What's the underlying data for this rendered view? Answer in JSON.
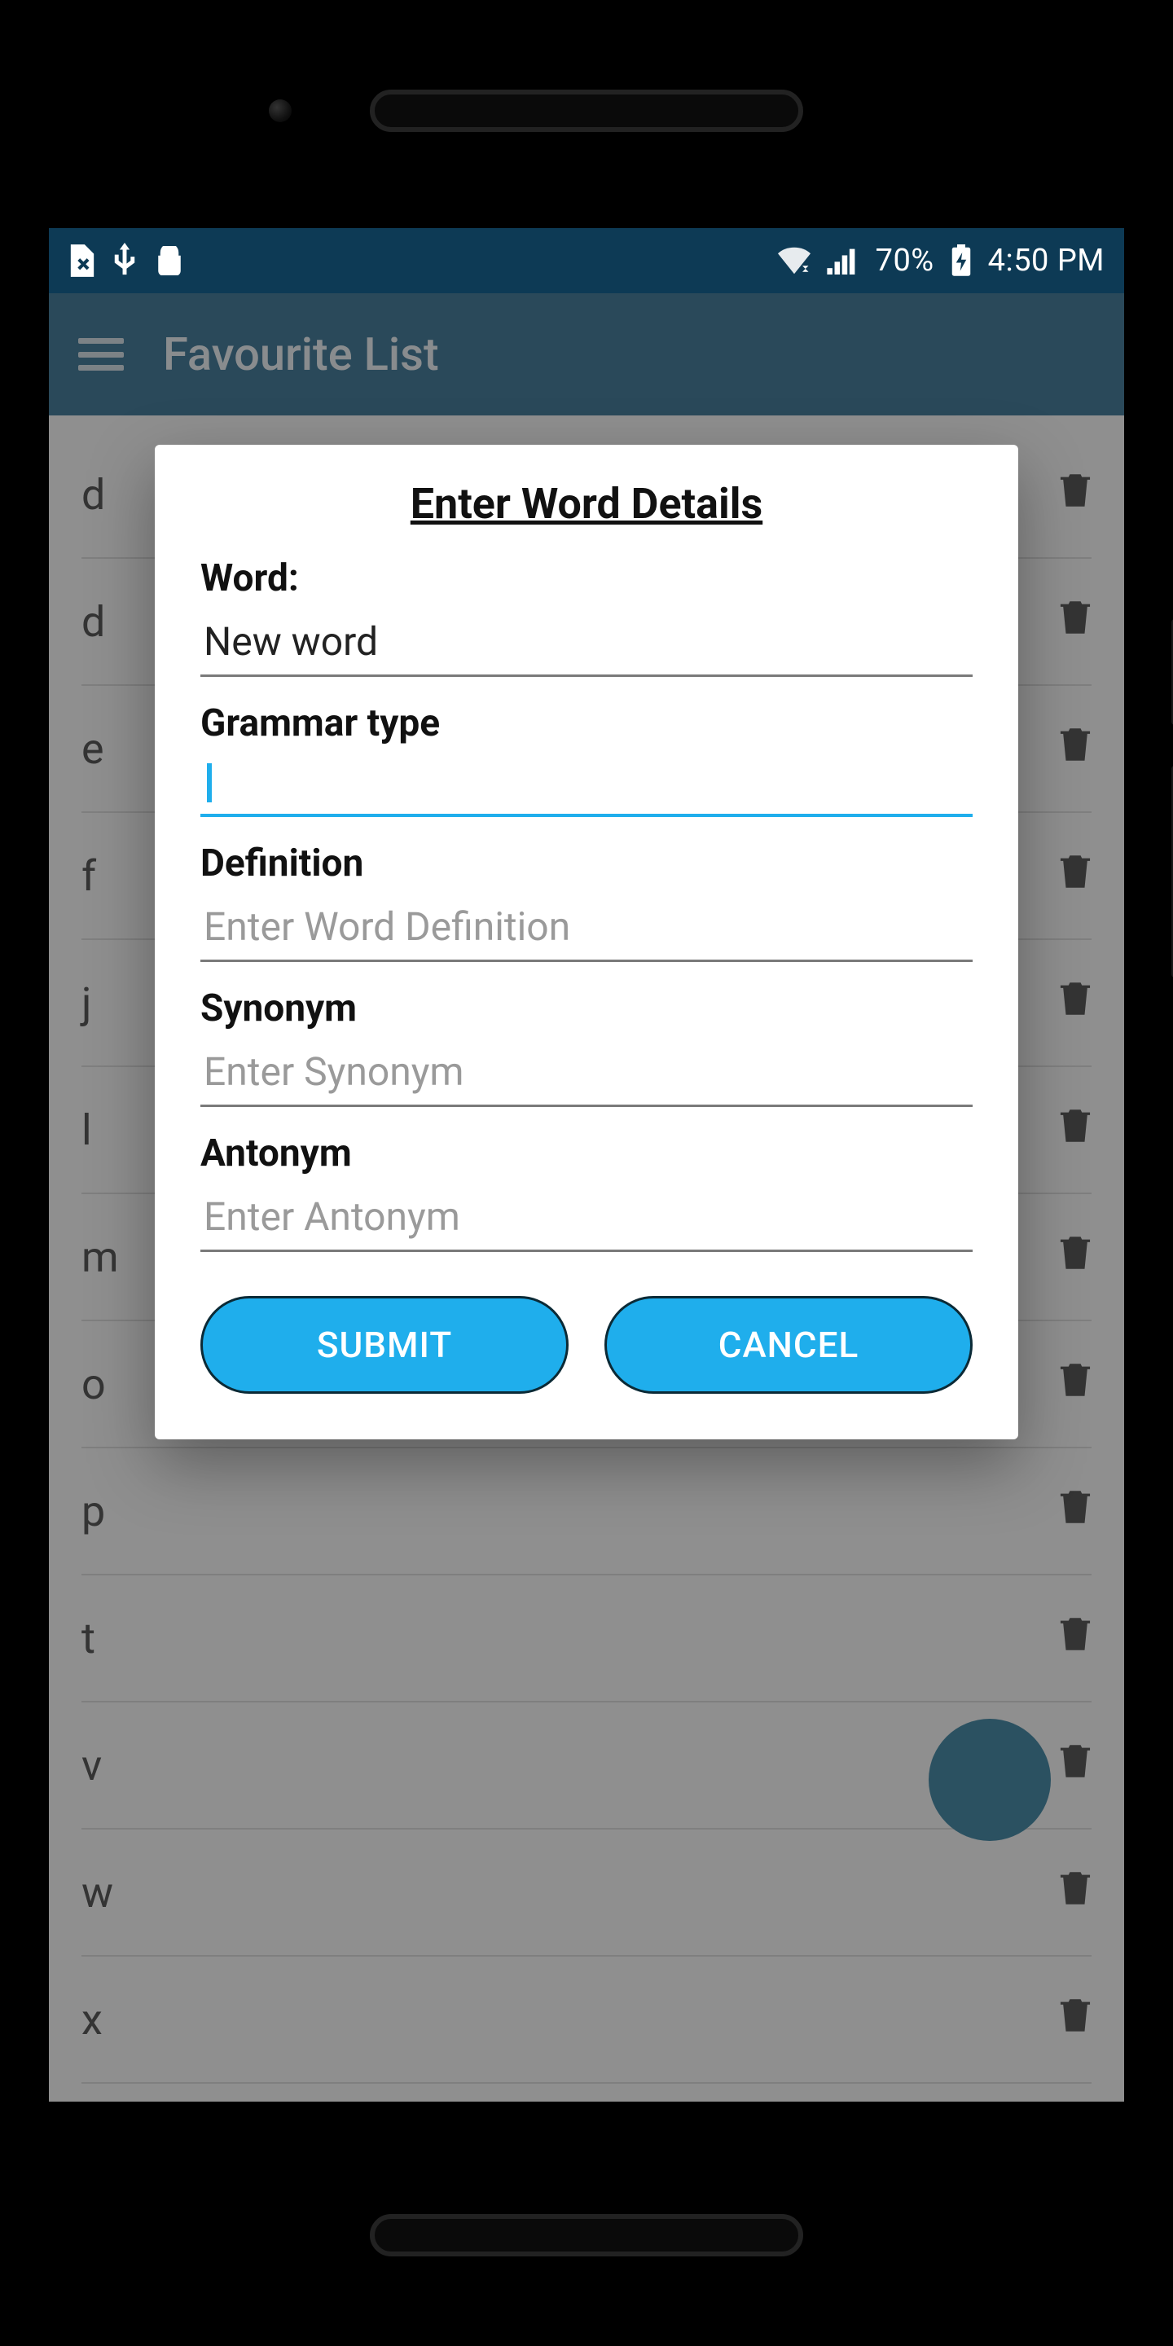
{
  "statusbar": {
    "battery_pct": "70%",
    "time": "4:50 PM"
  },
  "appbar": {
    "title": "Favourite List"
  },
  "list": {
    "items": [
      "d",
      "d",
      "e",
      "f",
      "j",
      "l",
      "m",
      "o",
      "p",
      "t",
      "v",
      "w",
      "x"
    ]
  },
  "dialog": {
    "title": "Enter Word Details",
    "fields": {
      "word_label": "Word:",
      "word_value": "New word",
      "grammar_label": "Grammar type",
      "grammar_value": "",
      "definition_label": "Definition",
      "definition_placeholder": "Enter Word Definition",
      "synonym_label": "Synonym",
      "synonym_placeholder": "Enter Synonym",
      "antonym_label": "Antonym",
      "antonym_placeholder": "Enter Antonym"
    },
    "submit_label": "SUBMIT",
    "cancel_label": "CANCEL"
  },
  "colors": {
    "statusbar": "#0d3a55",
    "appbar": "#155a7e",
    "accent": "#1faeec"
  }
}
